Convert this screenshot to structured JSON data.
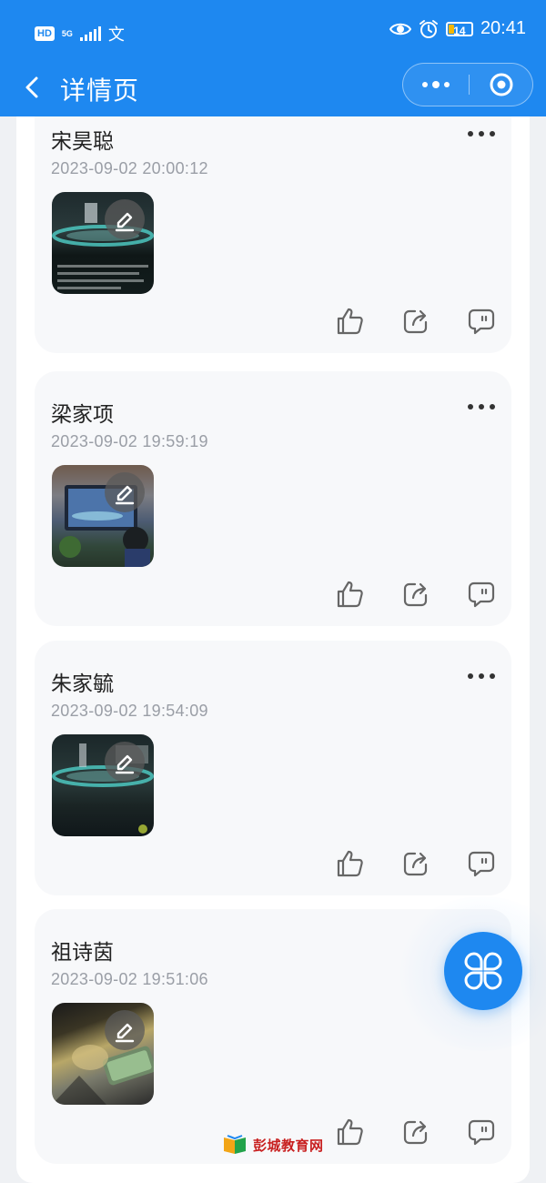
{
  "status_bar": {
    "hd": "HD",
    "network": "5G",
    "time": "20:41",
    "battery": "14",
    "battery_color": "#f5b700"
  },
  "nav": {
    "title": "详情页",
    "back_icon": "chevron-left-icon",
    "more_icon": "more-dots-icon",
    "close_icon": "target-circle-icon"
  },
  "colors": {
    "primary": "#1e88f0",
    "card_bg": "#f7f8fa",
    "timestamp": "#9a9ea6"
  },
  "posts": [
    {
      "name": "宋昊聪",
      "time": "2023-09-02 20:00:12"
    },
    {
      "name": "梁家项",
      "time": "2023-09-02 19:59:19"
    },
    {
      "name": "朱家毓",
      "time": "2023-09-02 19:54:09"
    },
    {
      "name": "祖诗茵",
      "time": "2023-09-02 19:51:06"
    }
  ],
  "post_actions": [
    "thumbs-up-icon",
    "share-icon",
    "comment-icon"
  ],
  "fab_icon": "menu-grid-icon",
  "watermark": {
    "text": "彭城教育网"
  }
}
